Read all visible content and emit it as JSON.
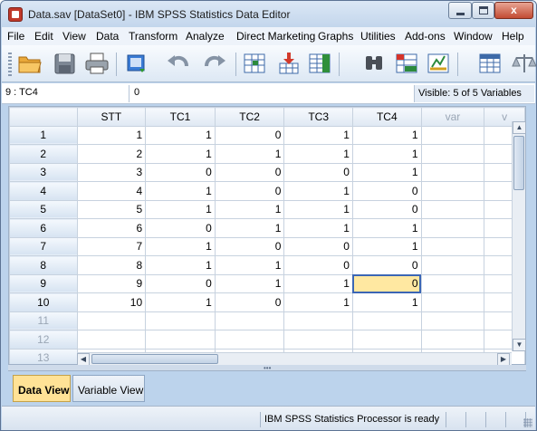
{
  "window": {
    "title": "Data.sav [DataSet0] - IBM SPSS Statistics Data Editor",
    "controls": {
      "minimize": "",
      "maximize": "",
      "close": "x"
    }
  },
  "menu": [
    "File",
    "Edit",
    "View",
    "Data",
    "Transform",
    "Analyze",
    "Direct Marketing",
    "Graphs",
    "Utilities",
    "Add-ons",
    "Window",
    "Help"
  ],
  "toolbar": {
    "icons": [
      "open-folder-icon",
      "save-icon",
      "print-icon",
      "recall-dialog-icon",
      "undo-icon",
      "redo-icon",
      "go-to-case-icon",
      "insert-variable-icon",
      "insert-cases-icon",
      "find-icon",
      "split-file-icon",
      "weight-cases-icon",
      "value-labels-icon",
      "scale-icon"
    ]
  },
  "cell_info": {
    "ref": "9 : TC4",
    "value": "0",
    "visible": "Visible: 5 of 5 Variables"
  },
  "grid": {
    "columns": [
      "STT",
      "TC1",
      "TC2",
      "TC3",
      "TC4",
      "var",
      "v"
    ],
    "rows": [
      {
        "num": "1",
        "values": [
          "1",
          "1",
          "0",
          "1",
          "1"
        ]
      },
      {
        "num": "2",
        "values": [
          "2",
          "1",
          "1",
          "1",
          "1"
        ]
      },
      {
        "num": "3",
        "values": [
          "3",
          "0",
          "0",
          "0",
          "1"
        ]
      },
      {
        "num": "4",
        "values": [
          "4",
          "1",
          "0",
          "1",
          "0"
        ]
      },
      {
        "num": "5",
        "values": [
          "5",
          "1",
          "1",
          "1",
          "0"
        ]
      },
      {
        "num": "6",
        "values": [
          "6",
          "0",
          "1",
          "1",
          "1"
        ]
      },
      {
        "num": "7",
        "values": [
          "7",
          "1",
          "0",
          "0",
          "1"
        ]
      },
      {
        "num": "8",
        "values": [
          "8",
          "1",
          "1",
          "0",
          "0"
        ]
      },
      {
        "num": "9",
        "values": [
          "9",
          "0",
          "1",
          "1",
          "0"
        ]
      },
      {
        "num": "10",
        "values": [
          "10",
          "1",
          "0",
          "1",
          "1"
        ]
      },
      {
        "num": "11",
        "values": [
          "",
          "",
          "",
          "",
          ""
        ]
      },
      {
        "num": "12",
        "values": [
          "",
          "",
          "",
          "",
          ""
        ]
      },
      {
        "num": "13",
        "values": [
          "",
          "",
          "",
          "",
          ""
        ]
      }
    ],
    "active_cell": {
      "row": "9",
      "column": "TC4"
    }
  },
  "tabs": {
    "data_view": "Data View",
    "variable_view": "Variable View"
  },
  "status": {
    "text": "IBM SPSS Statistics Processor is ready"
  },
  "colors": {
    "active_tab": "#ffe296",
    "active_cell": "#ffe8a1",
    "chrome": "#bcd3ec"
  }
}
